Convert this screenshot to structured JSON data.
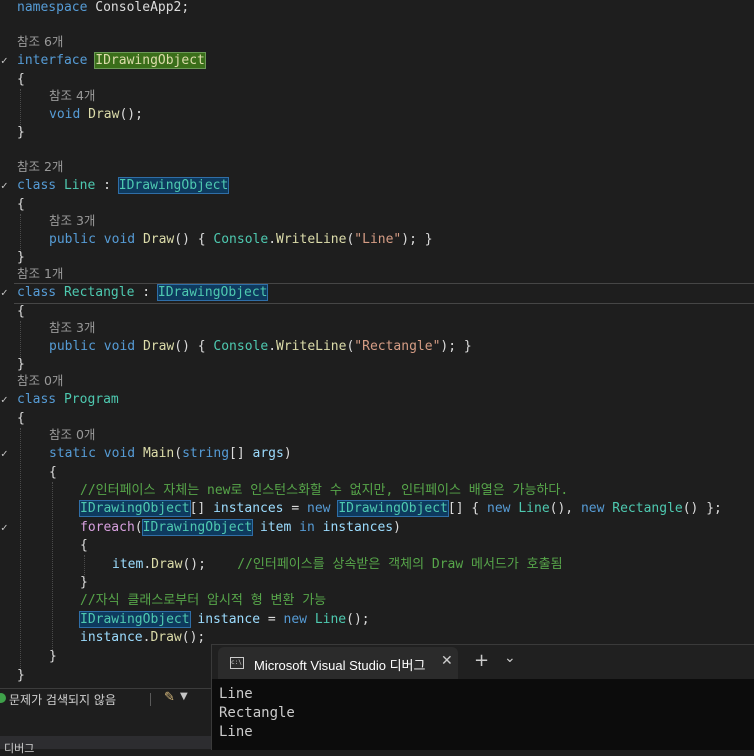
{
  "editor": {
    "namespace_kw": "namespace",
    "namespace_name": "ConsoleApp2;",
    "lens": {
      "l1": "참조 6개",
      "l2": "참조 4개",
      "l3": "참조 2개",
      "l4": "참조 3개",
      "l5": "참조 1개",
      "l6": "참조 3개",
      "l7": "참조 0개",
      "l8": "참조 0개"
    },
    "kw_interface": "interface",
    "kw_class": "class",
    "kw_void": "void",
    "kw_public": "public",
    "kw_static": "static",
    "kw_string": "string",
    "kw_new": "new",
    "kw_foreach": "foreach",
    "kw_in": "in",
    "type_idraw": "IDrawingObject",
    "type_line": "Line",
    "type_rect": "Rectangle",
    "type_program": "Program",
    "type_console": "Console",
    "fn_draw": "Draw",
    "fn_writeline": "WriteLine",
    "fn_main": "Main",
    "str_line": "\"Line\"",
    "str_rect": "\"Rectangle\"",
    "var_args": "args",
    "var_instances": "instances",
    "var_item": "item",
    "var_instance": "instance",
    "comment1": "//인터페이스 자체는 new로 인스턴스화할 수 없지만, 인터페이스 배열은 가능하다.",
    "comment2": "//인터페이스를 상속받은 객체의 Draw 메서드가 호출됨",
    "comment3": "//자식 클래스로부터 암시적 형 변환 가능",
    "brace_open": "{",
    "brace_close": "}"
  },
  "statusbar": {
    "issues_text": "문제가 검색되지 않음",
    "bottom_tab": "디버그"
  },
  "terminal": {
    "title": "Microsoft Visual Studio 디버그",
    "new_tab": "+",
    "dropdown": "⌄",
    "output": [
      "Line",
      "Rectangle",
      "Line"
    ]
  },
  "colors": {
    "editor_bg": "#1e1e1e",
    "keyword": "#569cd6",
    "type": "#4ec9b0",
    "method": "#dcdcaa",
    "string": "#d69d85",
    "comment": "#57a64a",
    "variable": "#9cdcfe"
  }
}
